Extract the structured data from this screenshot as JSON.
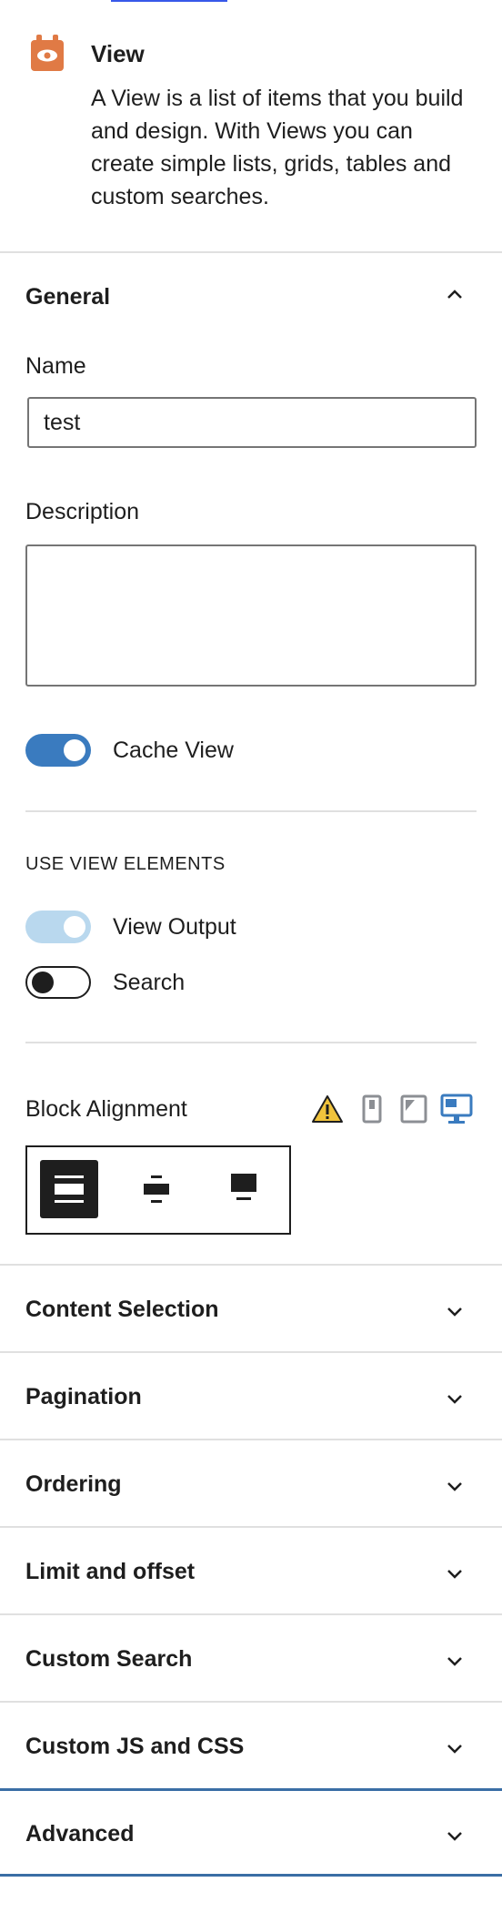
{
  "block": {
    "title": "View",
    "description": "A View is a list of items that you build and design. With Views you can create simple lists, grids, tables and custom searches.",
    "icon": "eye-icon",
    "icon_color": "#e07a45"
  },
  "general": {
    "title": "General",
    "name_label": "Name",
    "name_value": "test",
    "description_label": "Description",
    "description_value": "",
    "cache_label": "Cache View",
    "cache_on": true
  },
  "view_elements": {
    "heading": "USE VIEW ELEMENTS",
    "output_label": "View Output",
    "output_on": true,
    "search_label": "Search",
    "search_on": false
  },
  "block_alignment": {
    "label": "Block Alignment",
    "device_icons": [
      "warning-icon",
      "mobile-icon",
      "tablet-icon",
      "desktop-icon"
    ],
    "options": [
      "align-wide-icon",
      "align-center-icon",
      "align-full-icon"
    ],
    "selected": "align-wide-icon"
  },
  "panels": [
    {
      "title": "Content Selection"
    },
    {
      "title": "Pagination"
    },
    {
      "title": "Ordering"
    },
    {
      "title": "Limit and offset"
    },
    {
      "title": "Custom Search"
    },
    {
      "title": "Custom JS and CSS"
    },
    {
      "title": "Advanced"
    }
  ],
  "colors": {
    "accent": "#3a7bbf",
    "toggle_light": "#b9d8ee",
    "warning": "#f0c33c",
    "border": "#e0e0e0"
  }
}
